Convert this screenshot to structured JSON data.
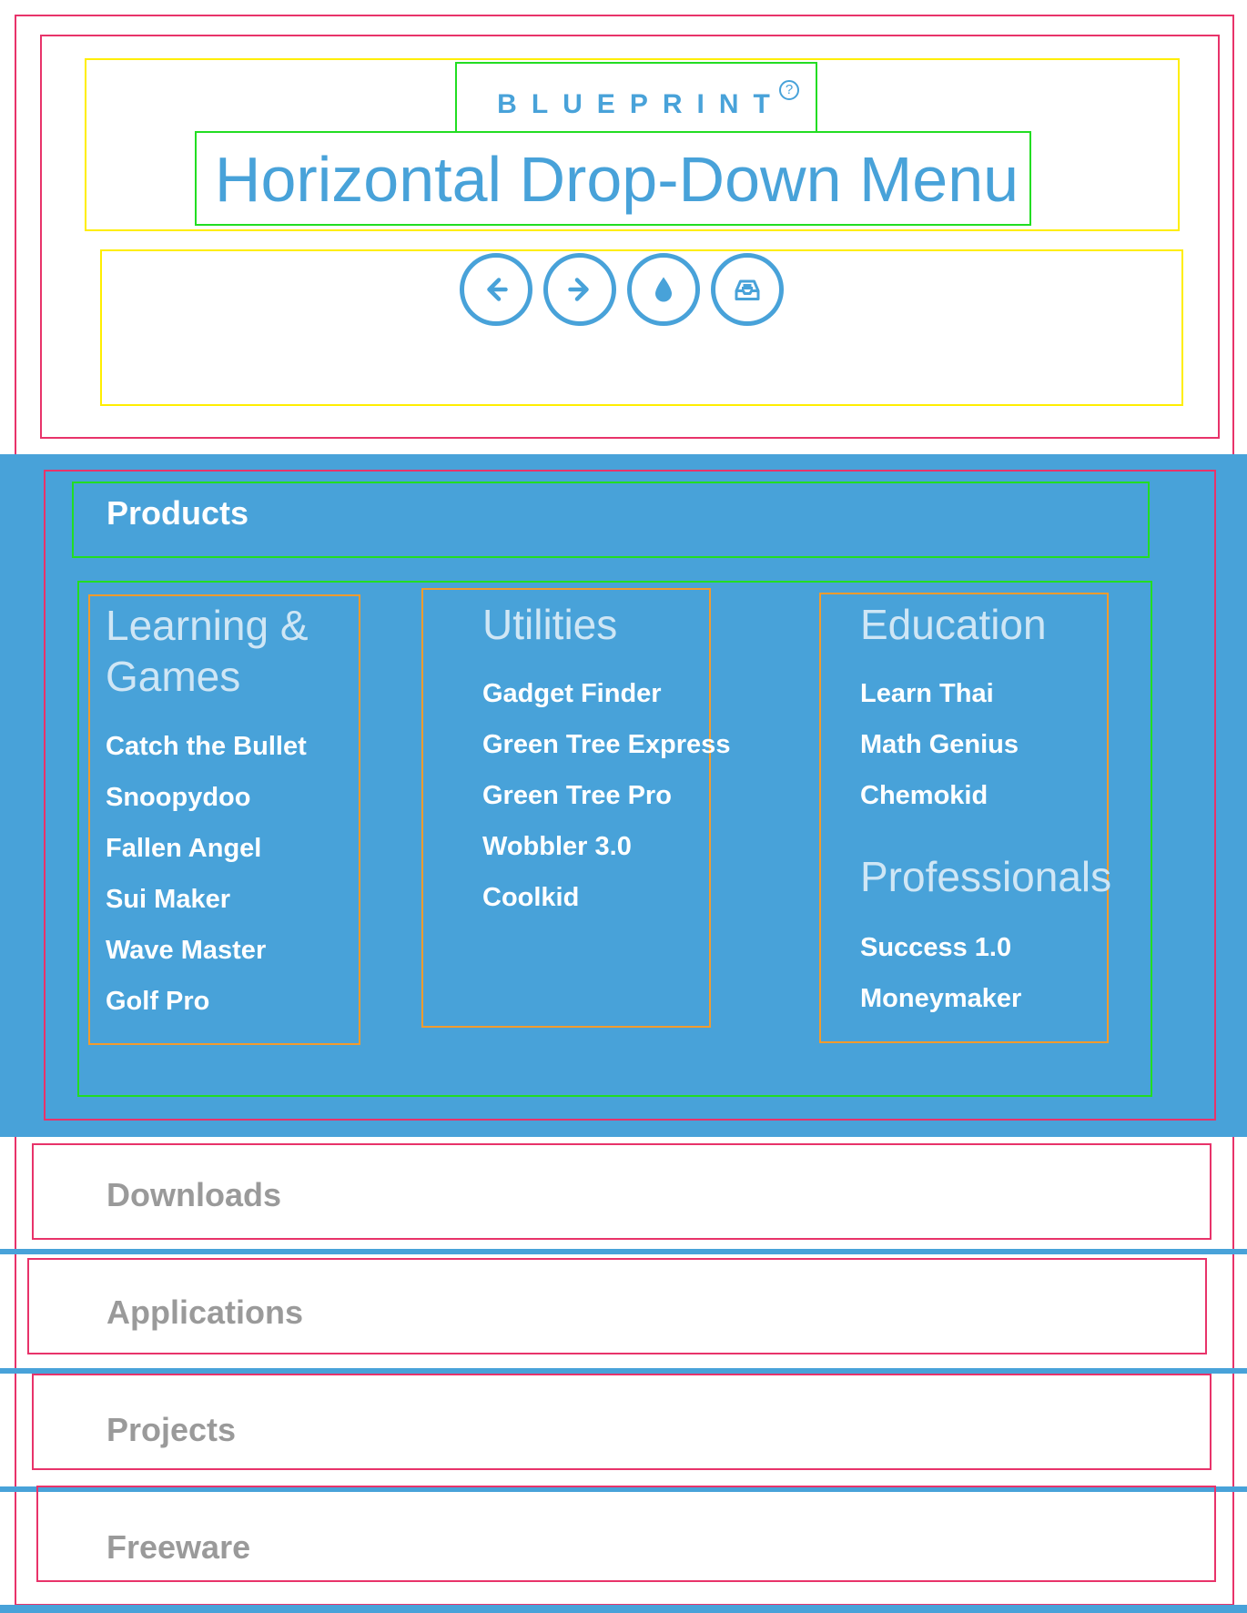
{
  "header": {
    "brand": "BLUEPRINT",
    "brand_help_icon": "?",
    "title": "Horizontal Drop-Down Menu"
  },
  "toolbar": {
    "buttons": [
      {
        "icon": "arrow-left-icon",
        "label": "Previous"
      },
      {
        "icon": "arrow-right-icon",
        "label": "Next"
      },
      {
        "icon": "water-drop-icon",
        "label": "Theme"
      },
      {
        "icon": "inbox-icon",
        "label": "Inbox"
      }
    ]
  },
  "nav": {
    "active": "Products",
    "columns": [
      {
        "sections": [
          {
            "heading": "Learning & Games",
            "links": [
              "Catch the Bullet",
              "Snoopydoo",
              "Fallen Angel",
              "Sui Maker",
              "Wave Master",
              "Golf Pro"
            ]
          }
        ]
      },
      {
        "sections": [
          {
            "heading": "Utilities",
            "links": [
              "Gadget Finder",
              "Green Tree Express",
              "Green Tree Pro",
              "Wobbler 3.0",
              "Coolkid"
            ]
          }
        ]
      },
      {
        "sections": [
          {
            "heading": "Education",
            "links": [
              "Learn Thai",
              "Math Genius",
              "Chemokid"
            ]
          },
          {
            "heading": "Professionals",
            "links": [
              "Success 1.0",
              "Moneymaker"
            ]
          }
        ]
      }
    ],
    "items": [
      "Downloads",
      "Applications",
      "Projects",
      "Freeware"
    ]
  },
  "colors": {
    "accent": "#48a2d9",
    "muted_text": "#9a9a9a",
    "heading_light": "#cfe6f5"
  }
}
